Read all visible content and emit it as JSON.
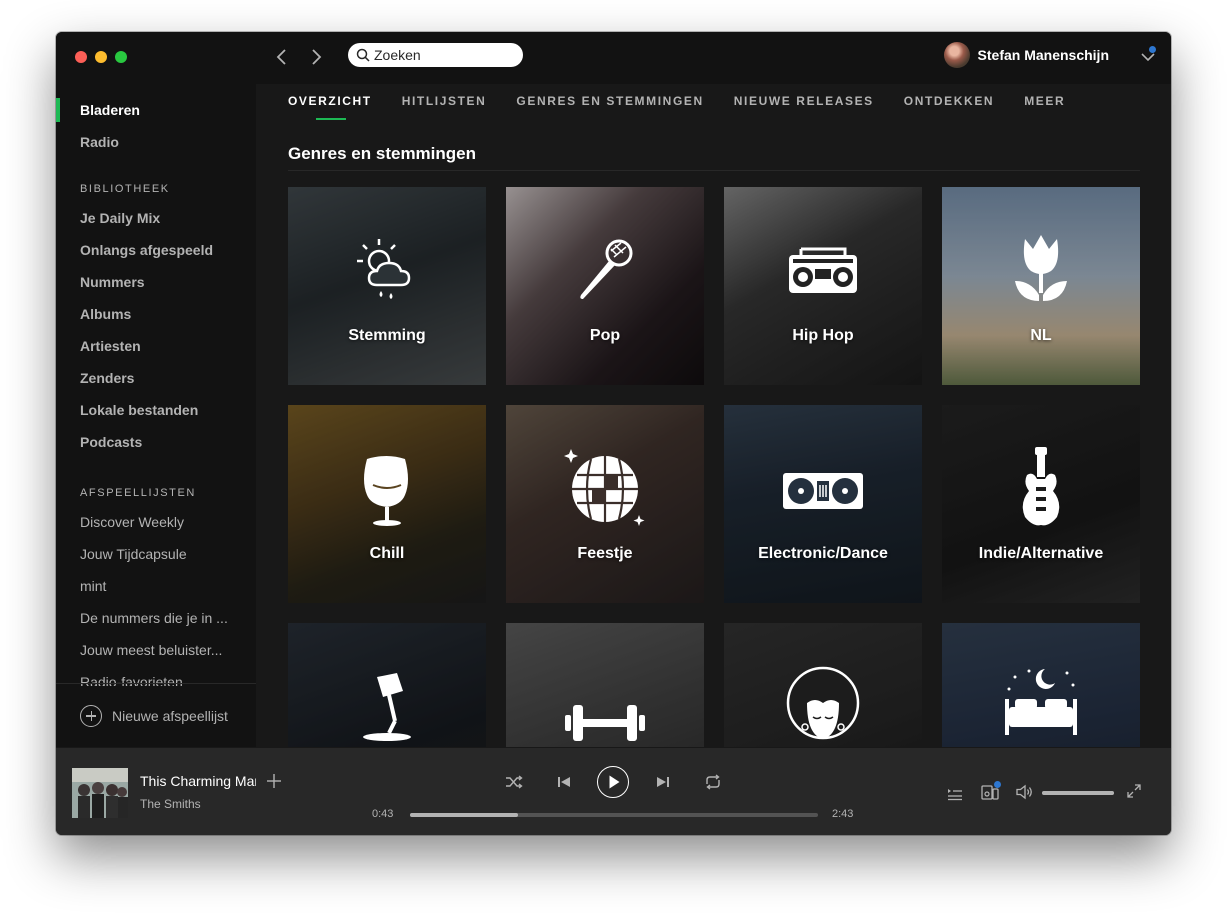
{
  "topbar": {
    "search_placeholder": "Zoeken",
    "user_name": "Stefan Manenschijn"
  },
  "sidebar": {
    "main": [
      {
        "label": "Bladeren",
        "active": true
      },
      {
        "label": "Radio",
        "active": false
      }
    ],
    "library_title": "BIBLIOTHEEK",
    "library": [
      {
        "label": "Je Daily Mix"
      },
      {
        "label": "Onlangs afgespeeld"
      },
      {
        "label": "Nummers"
      },
      {
        "label": "Albums"
      },
      {
        "label": "Artiesten"
      },
      {
        "label": "Zenders"
      },
      {
        "label": "Lokale bestanden"
      },
      {
        "label": "Podcasts"
      }
    ],
    "playlists_title": "AFSPEELLIJSTEN",
    "playlists": [
      {
        "label": "Discover Weekly"
      },
      {
        "label": "Jouw Tijdcapsule"
      },
      {
        "label": "mint"
      },
      {
        "label": "De nummers die je in ..."
      },
      {
        "label": "Jouw meest beluister..."
      },
      {
        "label": "Radio-favorieten"
      }
    ],
    "new_playlist": "Nieuwe afspeellijst"
  },
  "tabs": [
    {
      "label": "OVERZICHT",
      "active": true
    },
    {
      "label": "HITLIJSTEN",
      "active": false
    },
    {
      "label": "GENRES EN STEMMINGEN",
      "active": false
    },
    {
      "label": "NIEUWE RELEASES",
      "active": false
    },
    {
      "label": "ONTDEKKEN",
      "active": false
    },
    {
      "label": "MEER",
      "active": false
    }
  ],
  "main": {
    "section_title": "Genres en stemmingen",
    "tiles": [
      {
        "label": "Stemming",
        "icon": "weather-icon"
      },
      {
        "label": "Pop",
        "icon": "microphone-icon"
      },
      {
        "label": "Hip Hop",
        "icon": "boombox-icon"
      },
      {
        "label": "NL",
        "icon": "tulip-icon"
      },
      {
        "label": "Chill",
        "icon": "egg-chair-icon"
      },
      {
        "label": "Feestje",
        "icon": "disco-ball-icon"
      },
      {
        "label": "Electronic/Dance",
        "icon": "turntables-icon"
      },
      {
        "label": "Indie/Alternative",
        "icon": "guitar-icon"
      },
      {
        "label": "",
        "icon": "desk-lamp-icon"
      },
      {
        "label": "",
        "icon": "dumbbell-icon"
      },
      {
        "label": "",
        "icon": "afro-face-icon"
      },
      {
        "label": "",
        "icon": "bed-moon-icon"
      }
    ]
  },
  "player": {
    "track": "This Charming Man",
    "artist": "The Smiths",
    "elapsed": "0:43",
    "duration": "2:43",
    "progress_fraction": 0.264,
    "volume_fraction": 1.0
  },
  "colors": {
    "accent": "#1db954",
    "background": "#121212",
    "main_bg": "#181818",
    "player_bg": "#282828",
    "notification": "#2e77d0"
  }
}
